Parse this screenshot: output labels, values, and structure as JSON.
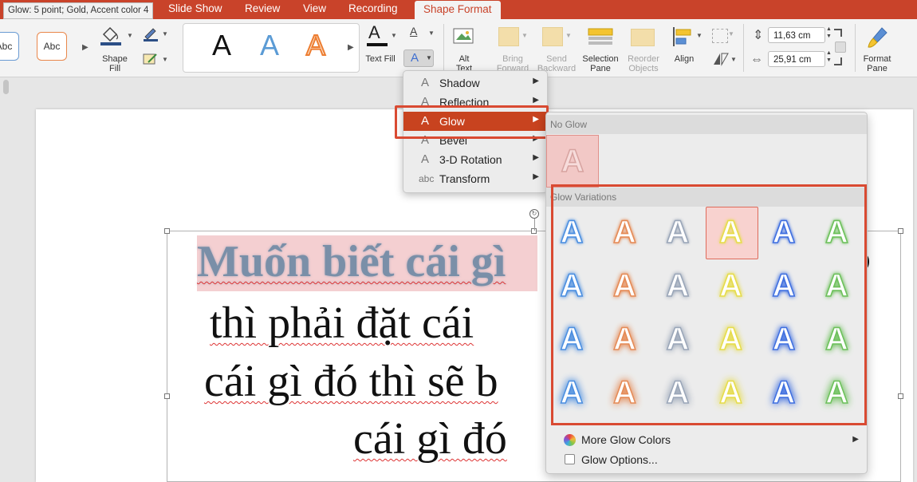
{
  "tooltip": "Glow: 5 point; Gold, Accent color 4",
  "tabs": [
    "Slide Show",
    "Review",
    "View",
    "Recording",
    "Shape Format"
  ],
  "ribbon": {
    "shape_styles_sample": "Abc",
    "shape_fill": "Shape\nFill",
    "wordart_letter": "A",
    "text_fill": "Text Fill",
    "text_effects_letter": "A",
    "alt_text": "Alt\nText",
    "bring_forward": "Bring\nForward",
    "send_backward": "Send\nBackward",
    "selection_pane": "Selection\nPane",
    "reorder_objects": "Reorder\nObjects",
    "align": "Align",
    "height_value": "11,63 cm",
    "width_value": "25,91 cm",
    "format_pane": "Format\nPane"
  },
  "slide": {
    "lines": [
      "Muốn biết cái gì",
      "thì phải đặt cái",
      "cái gì đó thì sẽ b",
      "cái gì đó"
    ]
  },
  "menu": {
    "items": [
      {
        "icon": "A",
        "label": "Shadow"
      },
      {
        "icon": "A",
        "label": "Reflection"
      },
      {
        "icon": "A",
        "label": "Glow"
      },
      {
        "icon": "A",
        "label": "Bevel"
      },
      {
        "icon": "A",
        "label": "3-D Rotation"
      },
      {
        "icon": "abc",
        "label": "Transform"
      }
    ],
    "selected": "Glow"
  },
  "gallery": {
    "no_glow_heading": "No Glow",
    "variations_heading": "Glow Variations",
    "letter": "A",
    "glow_colors": [
      "#4a8ee0",
      "#e58a55",
      "#9aa6b8",
      "#e6dc4a",
      "#3f6fe0",
      "#6cc05a"
    ],
    "selected_cell": {
      "row": 1,
      "col": 4
    },
    "more_colors": "More Glow Colors",
    "options": "Glow Options..."
  }
}
